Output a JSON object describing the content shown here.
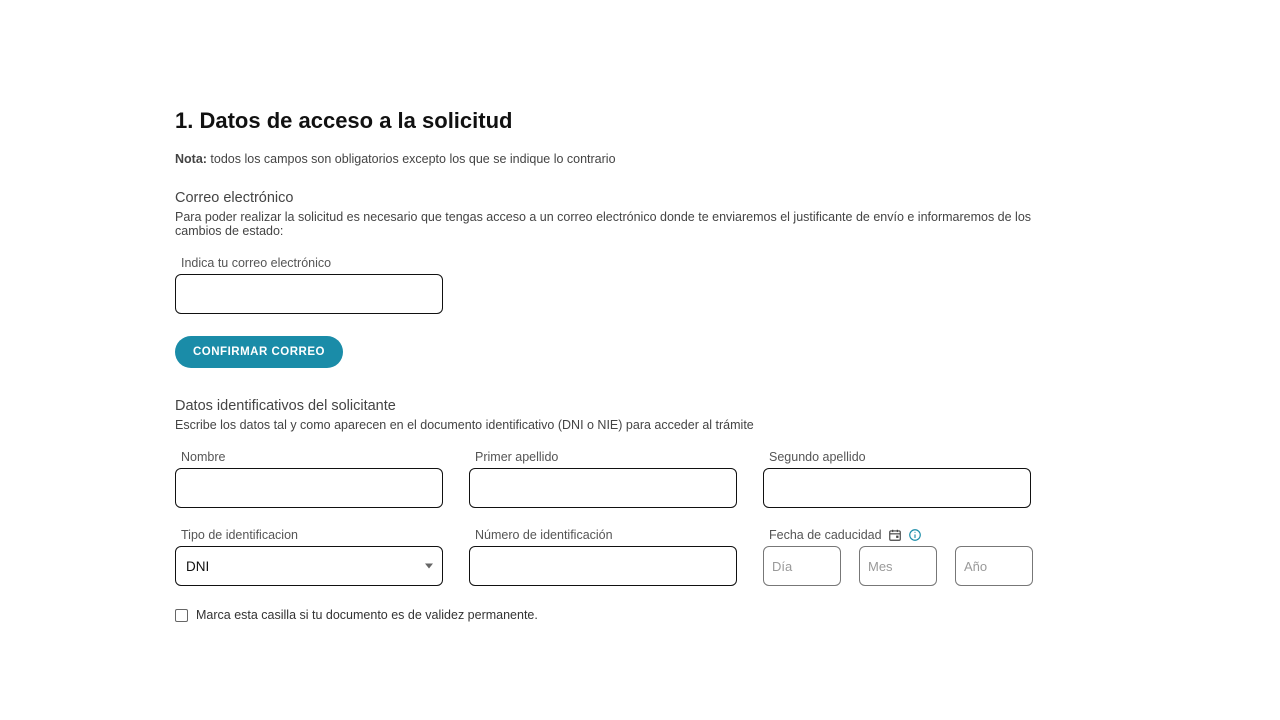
{
  "section": {
    "title": "1. Datos de acceso a la solicitud",
    "note_prefix": "Nota:",
    "note_text": " todos los campos son obligatorios excepto los que se indique lo contrario"
  },
  "email": {
    "heading": "Correo electrónico",
    "description": "Para poder realizar la solicitud es necesario que tengas acceso a un correo electrónico donde te enviaremos el justificante de envío e informaremos de los cambios de estado:",
    "label": "Indica tu correo electrónico",
    "value": "",
    "confirm_button": "CONFIRMAR CORREO"
  },
  "identity": {
    "heading": "Datos identificativos del solicitante",
    "description": "Escribe los datos tal y como aparecen en el documento identificativo (DNI o NIE) para acceder al trámite",
    "name_label": "Nombre",
    "name_value": "",
    "surname1_label": "Primer apellido",
    "surname1_value": "",
    "surname2_label": "Segundo apellido",
    "surname2_value": "",
    "id_type_label": "Tipo de identificacion",
    "id_type_selected": "DNI",
    "id_number_label": "Número de identificación",
    "id_number_value": "",
    "expiry_label": "Fecha de caducidad",
    "day_placeholder": "Día",
    "month_placeholder": "Mes",
    "year_placeholder": "Año",
    "day_value": "",
    "month_value": "",
    "year_value": "",
    "permanent_checkbox_label": "Marca esta casilla si tu documento es de validez permanente."
  }
}
